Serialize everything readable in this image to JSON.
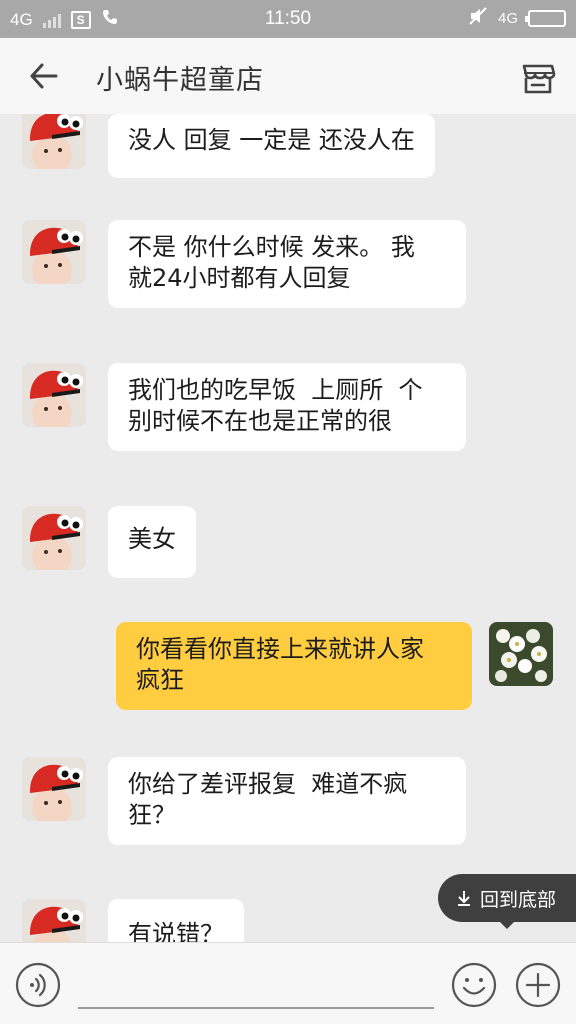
{
  "status_bar": {
    "network_left": "4G",
    "sim_icon_text": "S",
    "time": "11:50",
    "network_right": "4G"
  },
  "header": {
    "title": "小蜗牛超童店",
    "back_icon": "arrow-left-icon",
    "store_icon": "store-icon"
  },
  "messages": [
    {
      "side": "in",
      "text": "没人 回复 一定是 还没人在"
    },
    {
      "side": "in",
      "text": "不是 你什么时候 发来。 我\n就24小时都有人回复"
    },
    {
      "side": "in",
      "text": "我们也的吃早饭  上厕所  个\n别时候不在也是正常的很"
    },
    {
      "side": "in",
      "text": "美女"
    },
    {
      "side": "out",
      "text": "你看看你直接上来就讲人家\n疯狂"
    },
    {
      "side": "in",
      "text": "你给了差评报复  难道不疯\n狂？"
    },
    {
      "side": "in",
      "text": "有说错？"
    }
  ],
  "back_to_bottom": {
    "label": "回到底部",
    "icon": "arrow-down-icon"
  },
  "input_bar": {
    "voice_icon": "voice-icon",
    "placeholder": "",
    "emoji_icon": "smile-icon",
    "plus_icon": "plus-icon"
  },
  "colors": {
    "incoming_bubble": "#FFFFFF",
    "outgoing_bubble": "#FFCD3F",
    "chat_background": "#EBEBEB",
    "status_bar": "#A8A8A8"
  }
}
